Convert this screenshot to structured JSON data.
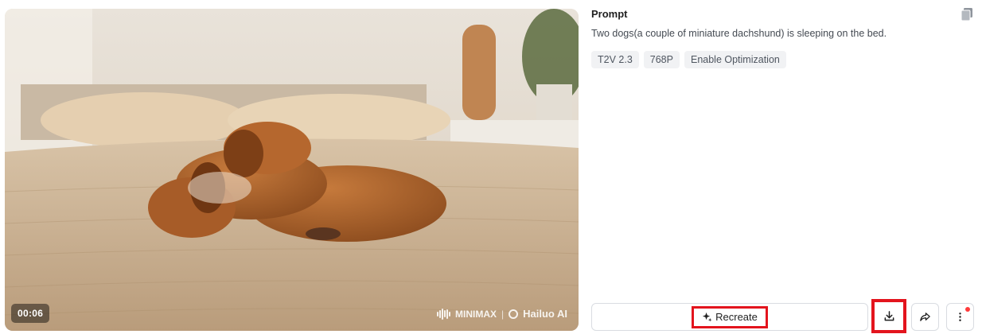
{
  "video": {
    "timecode": "00:06",
    "watermark": {
      "brand1": "MINIMAX",
      "separator": "|",
      "brand2": "Hailuo AI"
    }
  },
  "prompt": {
    "title": "Prompt",
    "text": "Two dogs(a couple of miniature dachshund) is sleeping on the bed.",
    "copy_icon": "copy-icon"
  },
  "tags": [
    "T2V 2.3",
    "768P",
    "Enable Optimization"
  ],
  "actions": {
    "recreate_label": "Recreate",
    "recreate_icon": "sparkle-icon",
    "download_icon": "download-icon",
    "share_icon": "share-icon",
    "more_icon": "more-vertical-icon"
  },
  "colors": {
    "highlight": "#e3141d",
    "notification_dot": "#ff3b3b",
    "tag_bg": "#f1f2f4"
  }
}
